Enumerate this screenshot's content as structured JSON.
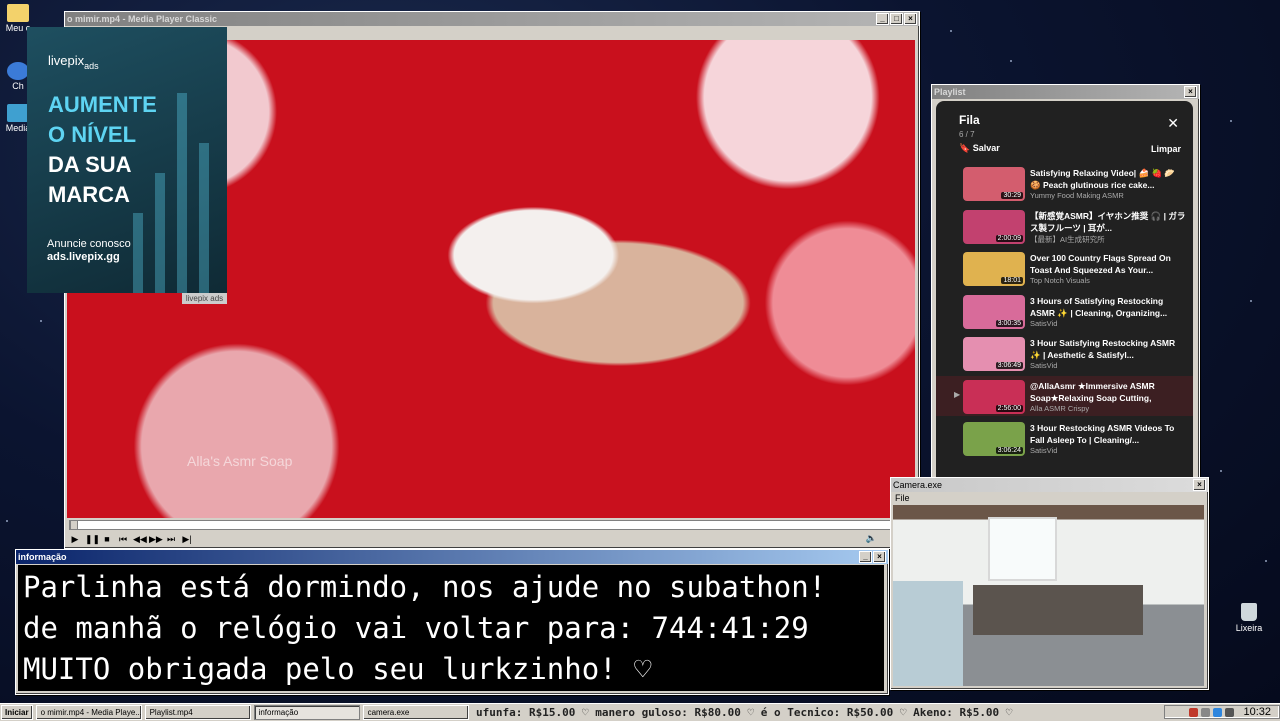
{
  "desktop": {
    "icons": [
      {
        "label": "Meu c"
      },
      {
        "label": "Ch"
      },
      {
        "label": "Media"
      }
    ],
    "recycle_label": "Lixeira"
  },
  "mpc": {
    "title": "o mimir.mp4 - Media Player Classic",
    "watermark": "Alla's Asmr Soap",
    "progress": 0.0
  },
  "ad": {
    "logo": "livepix",
    "logo_sub": "ads",
    "headline": [
      "AUMENTE",
      "O NÍVEL",
      "DA SUA",
      "MARCA"
    ],
    "cta_line1": "Anuncie conosco",
    "cta_line2": "ads.livepix.gg",
    "tag": "livepix ads"
  },
  "playlist": {
    "window_title": "Playlist",
    "header": "Fila",
    "count": "6 / 7",
    "save": "Salvar",
    "clear": "Limpar",
    "items": [
      {
        "title": "Satisfying Relaxing Video| 🍰 🍓 🥟 🍪 Peach glutinous rice cake...",
        "channel": "Yummy Food Making ASMR",
        "duration": "30:29",
        "current": false
      },
      {
        "title": "【新感覚ASMR】イヤホン推奨 🎧 | ガラス製フルーツ | 耳が...",
        "channel": "【最新】AI生成研究所",
        "duration": "2:00:09",
        "current": false
      },
      {
        "title": "Over 100 Country Flags Spread On Toast And Squeezed As Your...",
        "channel": "Top Notch Visuals",
        "duration": "18:01",
        "current": false
      },
      {
        "title": "3 Hours of Satisfying Restocking ASMR ✨ | Cleaning, Organizing...",
        "channel": "SatisVid",
        "duration": "3:00:35",
        "current": false
      },
      {
        "title": "3 Hour Satisfying Restocking ASMR ✨ | Aesthetic & Satisfyl...",
        "channel": "SatisVid",
        "duration": "3:06:49",
        "current": false
      },
      {
        "title": "@AllaAsmr ★Immersive ASMR Soap★Relaxing Soap Cutting, Crushin...",
        "channel": "Alla ASMR Crispy",
        "duration": "2:56:00",
        "current": true
      },
      {
        "title": "3 Hour Restocking ASMR Videos To Fall Asleep To | Cleaning/...",
        "channel": "SatisVid",
        "duration": "3:06:24",
        "current": false
      }
    ]
  },
  "info": {
    "title": "informação",
    "line1": "Parlinha está dormindo, nos ajude no subathon!",
    "line2": "de manhã o relógio vai voltar para:  744:41:29",
    "line3": "MUITO obrigada pelo seu lurkzinho! ♡"
  },
  "camera": {
    "title": "Camera.exe",
    "menu": "File"
  },
  "taskbar": {
    "start": "Iniciar",
    "tasks": [
      "o mimir.mp4 - Media Playe...",
      "Playlist.mp4",
      "informação",
      "camera.exe"
    ],
    "ticker": "ufunfa: R$15.00 ♡   manero guloso: R$80.00 ♡   é o Tecnico: R$50.00 ♡   Akeno: R$5.00 ♡",
    "clock": "10:32"
  },
  "colors": {
    "title_active": "#0a246a",
    "ad_accent": "#5ed4f2",
    "video_red": "#c9101d"
  }
}
